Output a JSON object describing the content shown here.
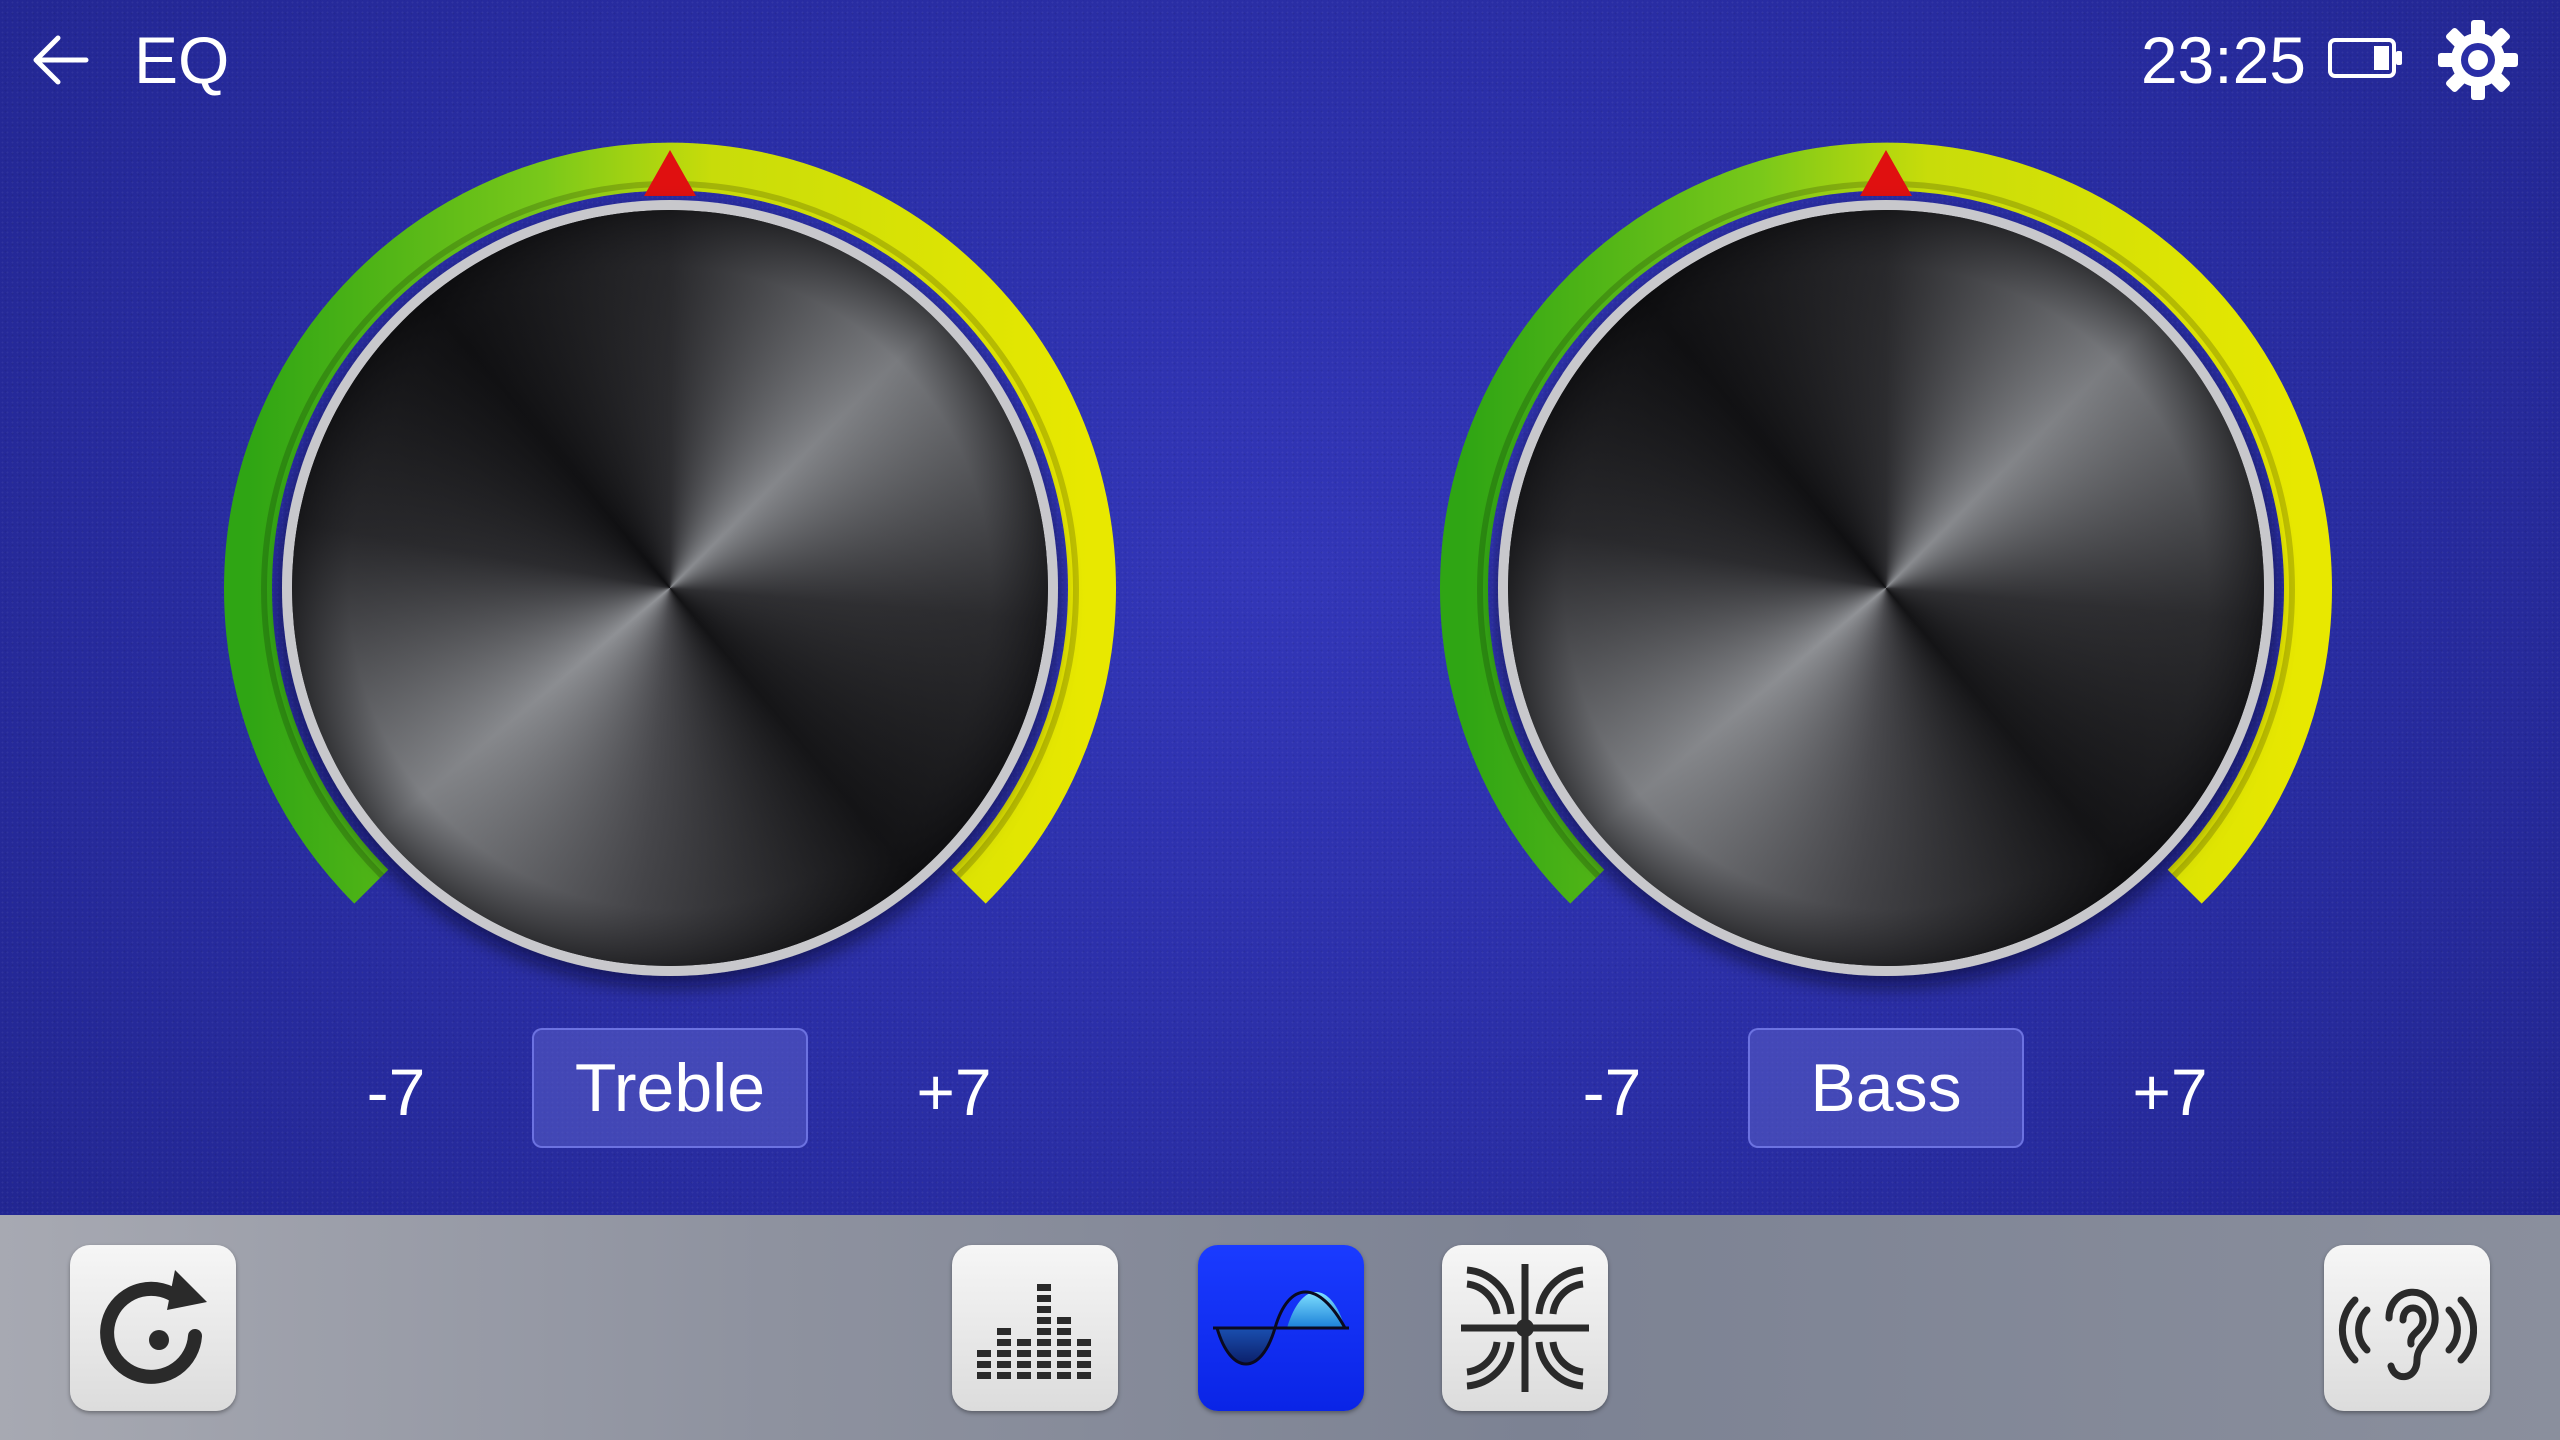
{
  "header": {
    "title": "EQ",
    "clock": "23:25"
  },
  "knobs": [
    {
      "name": "Treble",
      "min_label": "-7",
      "max_label": "+7"
    },
    {
      "name": "Bass",
      "min_label": "-7",
      "max_label": "+7"
    }
  ],
  "toolbar": {
    "buttons": [
      "reset-icon",
      "equalizer-bars-icon",
      "bass-treble-wave-icon",
      "speaker-balance-icon",
      "loudness-ear-icon"
    ],
    "active": "bass-treble-wave-icon"
  },
  "colors": {
    "background": "#2a2ea6",
    "ring_green": "#36b51a",
    "ring_yellow": "#e6e600",
    "pointer": "#e01010",
    "active_button": "#0a24e6"
  }
}
